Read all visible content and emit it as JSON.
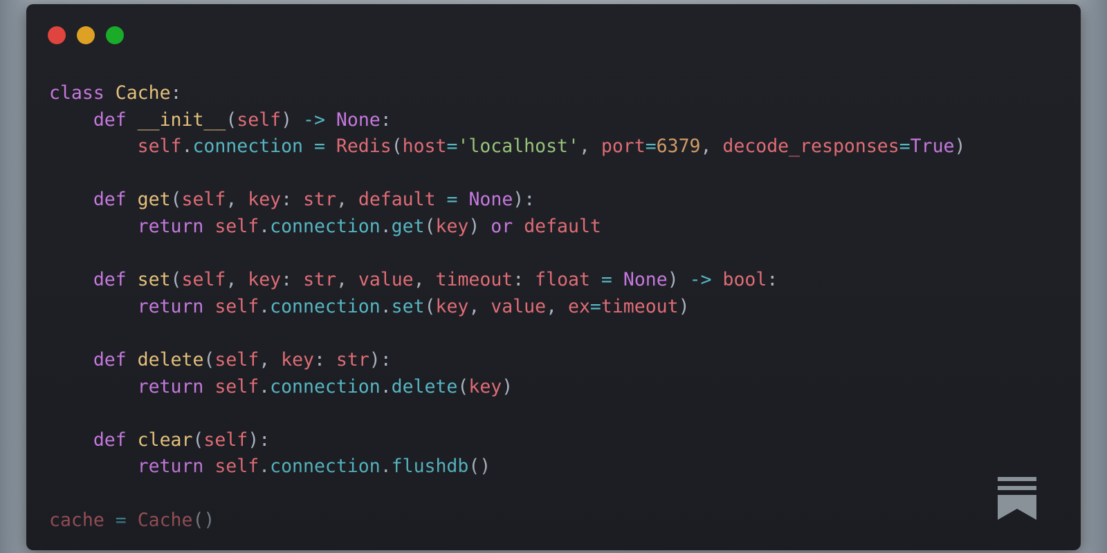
{
  "window": {
    "traffic_lights": [
      {
        "name": "close",
        "color": "#e0443e"
      },
      {
        "name": "minimize",
        "color": "#dea123"
      },
      {
        "name": "maximize",
        "color": "#1aab29"
      }
    ]
  },
  "theme": {
    "keyword": "#c678dd",
    "class_name": "#e5c07b",
    "function_name": "#e5c07b",
    "parameter": "#e06c75",
    "type": "#e06c75",
    "constant": "#c678dd",
    "string": "#98c379",
    "number": "#d19a66",
    "operator": "#56b6c2",
    "attribute": "#56b6c2",
    "punctuation": "#abb2bf"
  },
  "code": {
    "language": "python",
    "lines": [
      [
        {
          "t": "class",
          "k": "keyword"
        },
        {
          "t": " ",
          "k": "punctuation"
        },
        {
          "t": "Cache",
          "k": "class_name"
        },
        {
          "t": ":",
          "k": "punctuation"
        }
      ],
      [
        {
          "t": "    ",
          "k": "punctuation"
        },
        {
          "t": "def",
          "k": "keyword"
        },
        {
          "t": " ",
          "k": "punctuation"
        },
        {
          "t": "__init__",
          "k": "function_name"
        },
        {
          "t": "(",
          "k": "punctuation"
        },
        {
          "t": "self",
          "k": "parameter"
        },
        {
          "t": ") ",
          "k": "punctuation"
        },
        {
          "t": "->",
          "k": "operator"
        },
        {
          "t": " ",
          "k": "punctuation"
        },
        {
          "t": "None",
          "k": "constant"
        },
        {
          "t": ":",
          "k": "punctuation"
        }
      ],
      [
        {
          "t": "        ",
          "k": "punctuation"
        },
        {
          "t": "self",
          "k": "parameter"
        },
        {
          "t": ".",
          "k": "punctuation"
        },
        {
          "t": "connection",
          "k": "attribute"
        },
        {
          "t": " ",
          "k": "punctuation"
        },
        {
          "t": "=",
          "k": "operator"
        },
        {
          "t": " ",
          "k": "punctuation"
        },
        {
          "t": "Redis",
          "k": "parameter"
        },
        {
          "t": "(",
          "k": "punctuation"
        },
        {
          "t": "host",
          "k": "parameter"
        },
        {
          "t": "=",
          "k": "operator"
        },
        {
          "t": "'localhost'",
          "k": "string"
        },
        {
          "t": ", ",
          "k": "punctuation"
        },
        {
          "t": "port",
          "k": "parameter"
        },
        {
          "t": "=",
          "k": "operator"
        },
        {
          "t": "6379",
          "k": "number"
        },
        {
          "t": ", ",
          "k": "punctuation"
        },
        {
          "t": "decode_responses",
          "k": "parameter"
        },
        {
          "t": "=",
          "k": "operator"
        },
        {
          "t": "True",
          "k": "constant"
        },
        {
          "t": ")",
          "k": "punctuation"
        }
      ],
      [],
      [
        {
          "t": "    ",
          "k": "punctuation"
        },
        {
          "t": "def",
          "k": "keyword"
        },
        {
          "t": " ",
          "k": "punctuation"
        },
        {
          "t": "get",
          "k": "function_name"
        },
        {
          "t": "(",
          "k": "punctuation"
        },
        {
          "t": "self",
          "k": "parameter"
        },
        {
          "t": ", ",
          "k": "punctuation"
        },
        {
          "t": "key",
          "k": "parameter"
        },
        {
          "t": ": ",
          "k": "punctuation"
        },
        {
          "t": "str",
          "k": "type"
        },
        {
          "t": ", ",
          "k": "punctuation"
        },
        {
          "t": "default",
          "k": "parameter"
        },
        {
          "t": " ",
          "k": "punctuation"
        },
        {
          "t": "=",
          "k": "operator"
        },
        {
          "t": " ",
          "k": "punctuation"
        },
        {
          "t": "None",
          "k": "constant"
        },
        {
          "t": "):",
          "k": "punctuation"
        }
      ],
      [
        {
          "t": "        ",
          "k": "punctuation"
        },
        {
          "t": "return",
          "k": "keyword"
        },
        {
          "t": " ",
          "k": "punctuation"
        },
        {
          "t": "self",
          "k": "parameter"
        },
        {
          "t": ".",
          "k": "punctuation"
        },
        {
          "t": "connection",
          "k": "attribute"
        },
        {
          "t": ".",
          "k": "punctuation"
        },
        {
          "t": "get",
          "k": "attribute"
        },
        {
          "t": "(",
          "k": "punctuation"
        },
        {
          "t": "key",
          "k": "parameter"
        },
        {
          "t": ") ",
          "k": "punctuation"
        },
        {
          "t": "or",
          "k": "keyword"
        },
        {
          "t": " ",
          "k": "punctuation"
        },
        {
          "t": "default",
          "k": "parameter"
        }
      ],
      [],
      [
        {
          "t": "    ",
          "k": "punctuation"
        },
        {
          "t": "def",
          "k": "keyword"
        },
        {
          "t": " ",
          "k": "punctuation"
        },
        {
          "t": "set",
          "k": "function_name"
        },
        {
          "t": "(",
          "k": "punctuation"
        },
        {
          "t": "self",
          "k": "parameter"
        },
        {
          "t": ", ",
          "k": "punctuation"
        },
        {
          "t": "key",
          "k": "parameter"
        },
        {
          "t": ": ",
          "k": "punctuation"
        },
        {
          "t": "str",
          "k": "type"
        },
        {
          "t": ", ",
          "k": "punctuation"
        },
        {
          "t": "value",
          "k": "parameter"
        },
        {
          "t": ", ",
          "k": "punctuation"
        },
        {
          "t": "timeout",
          "k": "parameter"
        },
        {
          "t": ": ",
          "k": "punctuation"
        },
        {
          "t": "float",
          "k": "type"
        },
        {
          "t": " ",
          "k": "punctuation"
        },
        {
          "t": "=",
          "k": "operator"
        },
        {
          "t": " ",
          "k": "punctuation"
        },
        {
          "t": "None",
          "k": "constant"
        },
        {
          "t": ") ",
          "k": "punctuation"
        },
        {
          "t": "->",
          "k": "operator"
        },
        {
          "t": " ",
          "k": "punctuation"
        },
        {
          "t": "bool",
          "k": "type"
        },
        {
          "t": ":",
          "k": "punctuation"
        }
      ],
      [
        {
          "t": "        ",
          "k": "punctuation"
        },
        {
          "t": "return",
          "k": "keyword"
        },
        {
          "t": " ",
          "k": "punctuation"
        },
        {
          "t": "self",
          "k": "parameter"
        },
        {
          "t": ".",
          "k": "punctuation"
        },
        {
          "t": "connection",
          "k": "attribute"
        },
        {
          "t": ".",
          "k": "punctuation"
        },
        {
          "t": "set",
          "k": "attribute"
        },
        {
          "t": "(",
          "k": "punctuation"
        },
        {
          "t": "key",
          "k": "parameter"
        },
        {
          "t": ", ",
          "k": "punctuation"
        },
        {
          "t": "value",
          "k": "parameter"
        },
        {
          "t": ", ",
          "k": "punctuation"
        },
        {
          "t": "ex",
          "k": "parameter"
        },
        {
          "t": "=",
          "k": "operator"
        },
        {
          "t": "timeout",
          "k": "parameter"
        },
        {
          "t": ")",
          "k": "punctuation"
        }
      ],
      [],
      [
        {
          "t": "    ",
          "k": "punctuation"
        },
        {
          "t": "def",
          "k": "keyword"
        },
        {
          "t": " ",
          "k": "punctuation"
        },
        {
          "t": "delete",
          "k": "function_name"
        },
        {
          "t": "(",
          "k": "punctuation"
        },
        {
          "t": "self",
          "k": "parameter"
        },
        {
          "t": ", ",
          "k": "punctuation"
        },
        {
          "t": "key",
          "k": "parameter"
        },
        {
          "t": ": ",
          "k": "punctuation"
        },
        {
          "t": "str",
          "k": "type"
        },
        {
          "t": "):",
          "k": "punctuation"
        }
      ],
      [
        {
          "t": "        ",
          "k": "punctuation"
        },
        {
          "t": "return",
          "k": "keyword"
        },
        {
          "t": " ",
          "k": "punctuation"
        },
        {
          "t": "self",
          "k": "parameter"
        },
        {
          "t": ".",
          "k": "punctuation"
        },
        {
          "t": "connection",
          "k": "attribute"
        },
        {
          "t": ".",
          "k": "punctuation"
        },
        {
          "t": "delete",
          "k": "attribute"
        },
        {
          "t": "(",
          "k": "punctuation"
        },
        {
          "t": "key",
          "k": "parameter"
        },
        {
          "t": ")",
          "k": "punctuation"
        }
      ],
      [],
      [
        {
          "t": "    ",
          "k": "punctuation"
        },
        {
          "t": "def",
          "k": "keyword"
        },
        {
          "t": " ",
          "k": "punctuation"
        },
        {
          "t": "clear",
          "k": "function_name"
        },
        {
          "t": "(",
          "k": "punctuation"
        },
        {
          "t": "self",
          "k": "parameter"
        },
        {
          "t": "):",
          "k": "punctuation"
        }
      ],
      [
        {
          "t": "        ",
          "k": "punctuation"
        },
        {
          "t": "return",
          "k": "keyword"
        },
        {
          "t": " ",
          "k": "punctuation"
        },
        {
          "t": "self",
          "k": "parameter"
        },
        {
          "t": ".",
          "k": "punctuation"
        },
        {
          "t": "connection",
          "k": "attribute"
        },
        {
          "t": ".",
          "k": "punctuation"
        },
        {
          "t": "flushdb",
          "k": "attribute"
        },
        {
          "t": "()",
          "k": "punctuation"
        }
      ],
      [],
      [
        {
          "t": "cache",
          "k": "parameter"
        },
        {
          "t": " ",
          "k": "punctuation"
        },
        {
          "t": "=",
          "k": "operator"
        },
        {
          "t": " ",
          "k": "punctuation"
        },
        {
          "t": "Cache",
          "k": "parameter"
        },
        {
          "t": "()",
          "k": "punctuation"
        }
      ]
    ]
  },
  "brand": {
    "icon": "bookmark-logo-icon",
    "color": "#8a9299"
  }
}
